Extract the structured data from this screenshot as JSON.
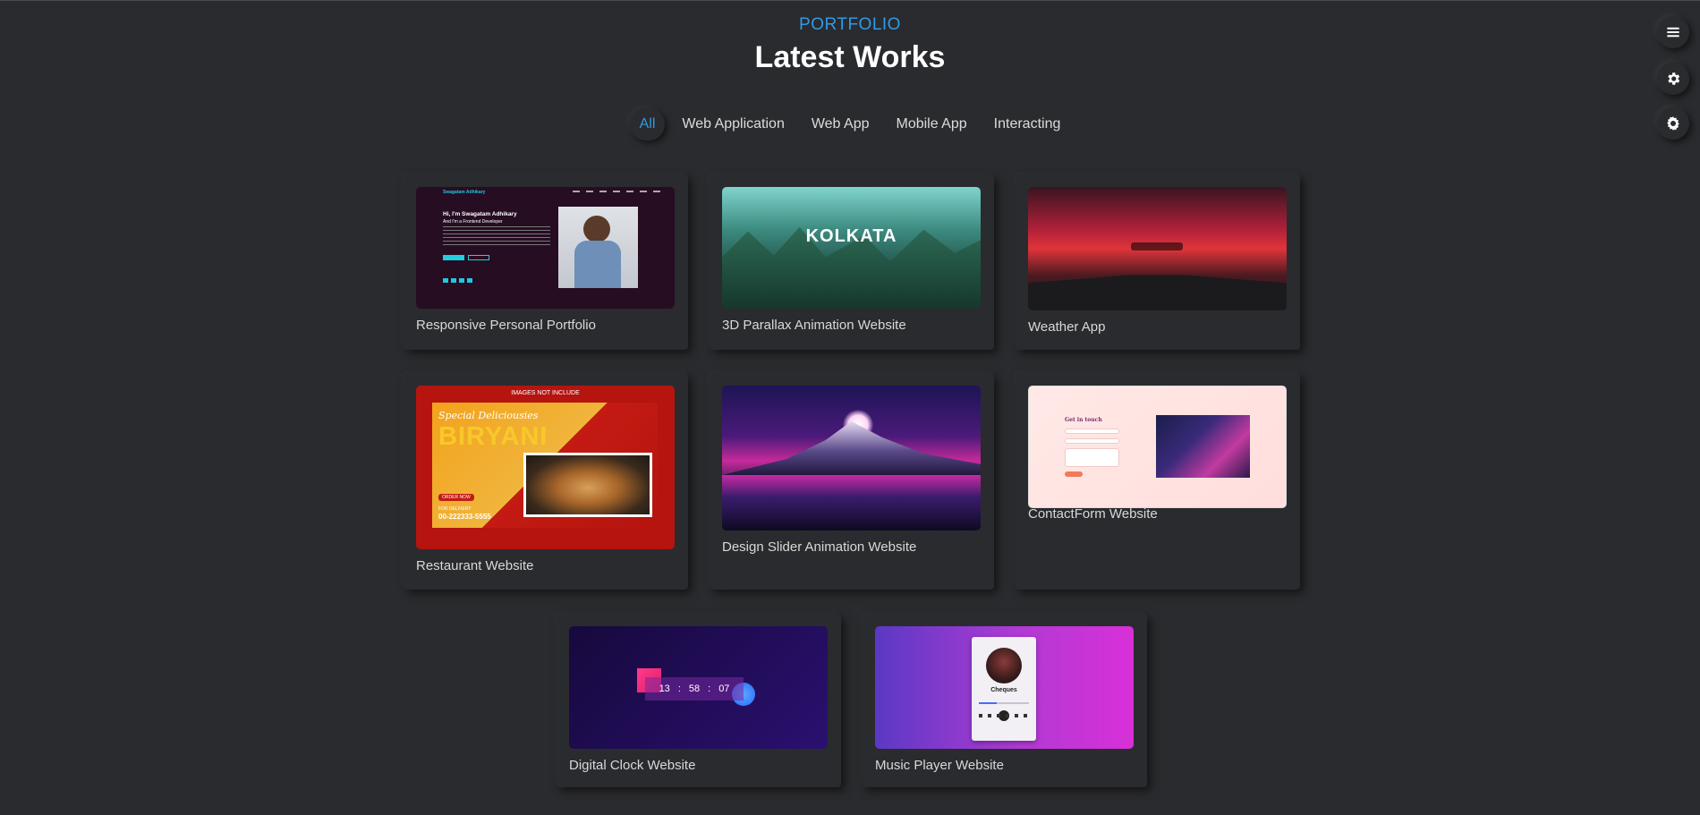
{
  "header": {
    "eyebrow": "PORTFOLIO",
    "title": "Latest Works"
  },
  "filters": [
    "All",
    "Web Application",
    "Web App",
    "Mobile App",
    "Interacting"
  ],
  "active_filter": "All",
  "side_buttons": [
    "menu-icon",
    "gear-icon",
    "settings-icon"
  ],
  "colors": {
    "accent": "#2f9be6",
    "background": "#2a2b2e"
  },
  "projects": [
    {
      "label": "Responsive Personal Portfolio",
      "thumb_text": {
        "brand": "Swagatam Adhikary",
        "greeting": "Hi, I'm Swagatam Adhikary",
        "role": "And I'm a Frontend Developer"
      }
    },
    {
      "label": "3D Parallax Animation Website",
      "thumb_text": {
        "heading": "KOLKATA"
      }
    },
    {
      "label": "Weather App"
    },
    {
      "label": "Restaurant Website",
      "thumb_text": {
        "banner": "IMAGES NOT INCLUDE",
        "script": "Special Deliciousies",
        "headline": "BIRYANI",
        "cta": "ORDER NOW",
        "delivery": "FOR DELIVERY",
        "phone": "00-222333-5555"
      }
    },
    {
      "label": "Design Slider Animation Website"
    },
    {
      "label": "ContactForm Website",
      "thumb_text": {
        "heading": "Get in touch"
      }
    },
    {
      "label": "Digital Clock Website",
      "thumb_text": {
        "hours": "13",
        "minutes": "58",
        "seconds": "07"
      }
    },
    {
      "label": "Music Player Website",
      "thumb_text": {
        "song": "Cheques"
      }
    }
  ]
}
